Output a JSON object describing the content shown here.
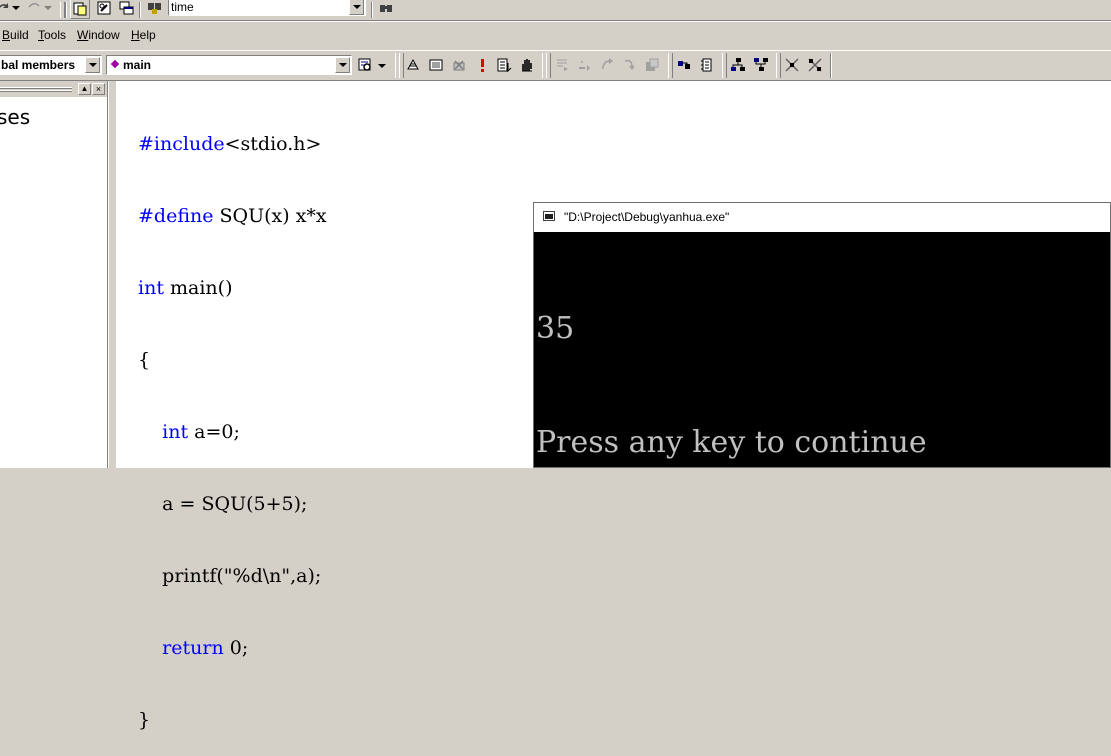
{
  "toolbar_top": {
    "find_combo_value": "time"
  },
  "menu": {
    "items": [
      {
        "label": "Build",
        "mn": "B",
        "rest": "uild"
      },
      {
        "label": "Tools",
        "mn": "T",
        "rest": "ools"
      },
      {
        "label": "Window",
        "mn": "W",
        "rest": "indow"
      },
      {
        "label": "Help",
        "mn": "H",
        "rest": "elp"
      }
    ]
  },
  "wizardbar": {
    "scope_value": "bal members",
    "function_value": "main"
  },
  "left_pane": {
    "visible_text": "ses"
  },
  "editor": {
    "lines": [
      {
        "kw": "#include",
        "rest": "<stdio.h>",
        "indent": ""
      },
      {
        "kw": "#define",
        "rest": " SQU(x) x*x",
        "indent": ""
      },
      {
        "kw": "int",
        "rest": " main()",
        "indent": ""
      },
      {
        "kw": "",
        "rest": "{",
        "indent": ""
      },
      {
        "kw": "int",
        "rest": " a=0;",
        "indent": "    "
      },
      {
        "kw": "",
        "rest": "a = SQU(5+5);",
        "indent": "    "
      },
      {
        "kw": "",
        "rest": "printf(\"%d\\n\",a);",
        "indent": "    "
      },
      {
        "kw": "return",
        "rest": " 0;",
        "indent": "    "
      },
      {
        "kw": "",
        "rest": "}",
        "indent": ""
      }
    ]
  },
  "console": {
    "title": "\"D:\\Project\\Debug\\yanhua.exe\"",
    "output_line1": "35",
    "output_line2": "Press any key to continue"
  },
  "colors": {
    "keyword": "#0000ff",
    "console_bg": "#000000",
    "console_text": "#c0c0c0",
    "chrome": "#d4d0c8"
  }
}
